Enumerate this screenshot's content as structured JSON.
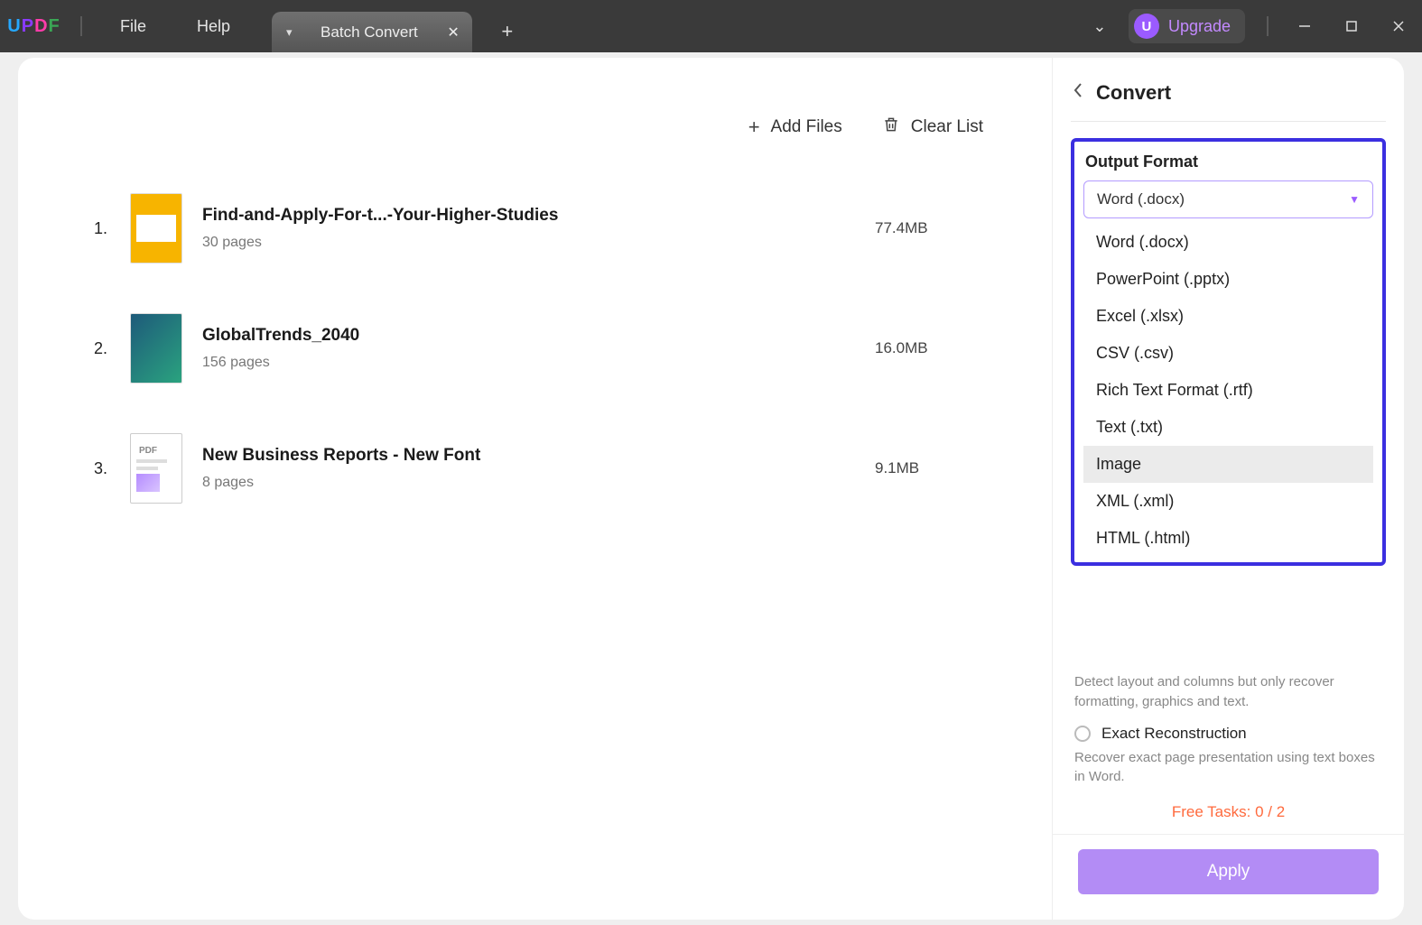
{
  "titlebar": {
    "logo_text": "UPDF",
    "menu": {
      "file": "File",
      "help": "Help"
    },
    "tab_label": "Batch Convert",
    "upgrade": "Upgrade",
    "avatar_letter": "U"
  },
  "actions": {
    "add_files": "Add Files",
    "clear_list": "Clear List"
  },
  "files": [
    {
      "index": "1.",
      "title": "Find-and-Apply-For-t...-Your-Higher-Studies",
      "pages": "30 pages",
      "size": "77.4MB"
    },
    {
      "index": "2.",
      "title": "GlobalTrends_2040",
      "pages": "156 pages",
      "size": "16.0MB"
    },
    {
      "index": "3.",
      "title": "New Business Reports - New Font",
      "pages": "8 pages",
      "size": "9.1MB"
    }
  ],
  "side": {
    "title": "Convert",
    "output_format_label": "Output Format",
    "selected_format": "Word (.docx)",
    "formats": [
      "Word (.docx)",
      "PowerPoint (.pptx)",
      "Excel (.xlsx)",
      "CSV (.csv)",
      "Rich Text Format (.rtf)",
      "Text (.txt)",
      "Image",
      "XML (.xml)",
      "HTML (.html)"
    ],
    "hovered_format_index": 6,
    "layout_desc1": "Detect layout and columns but only recover formatting, graphics and text.",
    "radio2_label": "Exact Reconstruction",
    "layout_desc2": "Recover exact page presentation using text boxes in Word.",
    "free_tasks": "Free Tasks: 0 / 2",
    "apply_label": "Apply"
  }
}
